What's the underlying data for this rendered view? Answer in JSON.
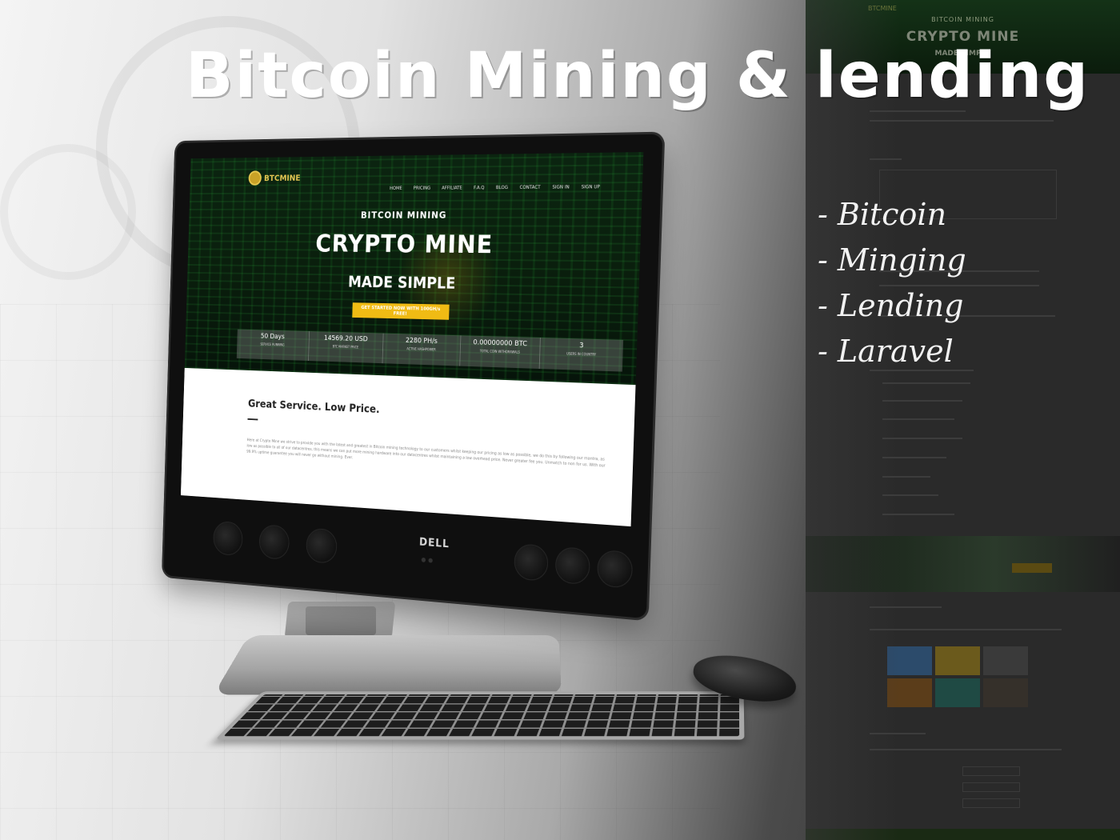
{
  "headline": "Bitcoin Mining & lending",
  "features": [
    "- Bitcoin",
    "- Minging",
    "-  Lending",
    "- Laravel"
  ],
  "website": {
    "logo_text": "BTCMINE",
    "nav": [
      "Home",
      "Pricing",
      "Affiliate",
      "F.A.Q",
      "Blog",
      "Contact",
      "Sign In",
      "Sign Up"
    ],
    "hero_subtitle": "BITCOIN MINING",
    "hero_title": "CRYPTO MINE",
    "hero_tagline": "MADE SIMPLE",
    "cta_label": "GET STARTED NOW WITH 100GH/s FREE!",
    "stats": [
      {
        "value": "50 Days",
        "label": "Service running"
      },
      {
        "value": "14569.20 USD",
        "label": "BTC market price"
      },
      {
        "value": "2280 PH/s",
        "label": "Active hashpower"
      },
      {
        "value": "0.00000000 BTC",
        "label": "Total coin withdrawals"
      },
      {
        "value": "3",
        "label": "Users in country"
      }
    ],
    "section_title": "Great Service. Low Price.",
    "section_text": "Here at Crypto Mine we strive to provide you with the latest and greatest in Bitcoin mining technology to our customers whilst keeping our pricing as low as possible, we do this by following our mantra, as low as possible to all of our datacentres, this means we can put more mining hardware into our datacentres whilst maintaining a low overhead price. Never greater fee you. Unmatch to non for us. With our 99.9% uptime guarantee you will never go without mining. Ever."
  },
  "device": {
    "brand": "DELL"
  },
  "strip": {
    "logo_text": "BTCMINE",
    "hero_subtitle": "BITCOIN MINING",
    "hero_title": "CRYPTO MINE",
    "hero_tagline": "MADE SIMPLE"
  }
}
